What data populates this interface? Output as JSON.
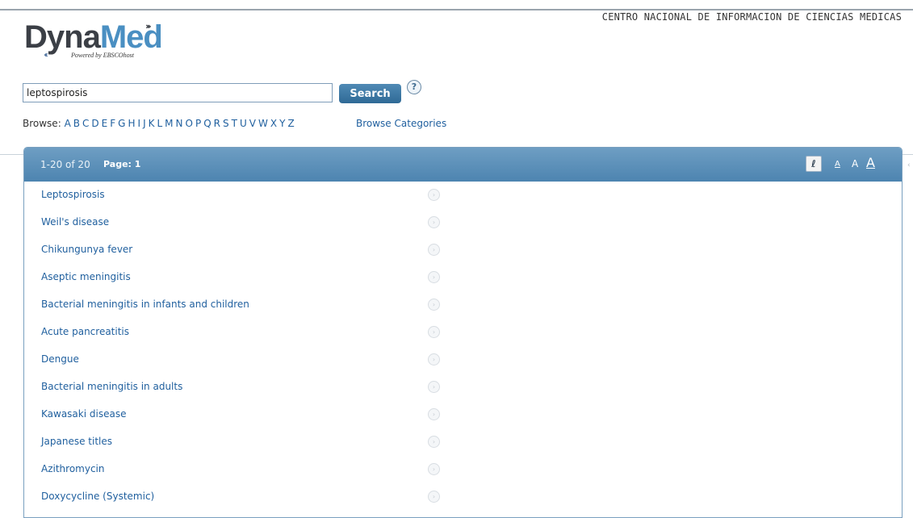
{
  "header": {
    "institution": "CENTRO NACIONAL DE INFORMACION DE CIENCIAS MEDICAS",
    "logo": {
      "part1": "Dyna",
      "part2": "Med",
      "tagline": "Powered by EBSCOhost"
    }
  },
  "search": {
    "value": "leptospirosis",
    "button_label": "Search",
    "help_label": "?"
  },
  "browse": {
    "label": "Browse:",
    "letters": [
      "A",
      "B",
      "C",
      "D",
      "E",
      "F",
      "G",
      "H",
      "I",
      "J",
      "K",
      "L",
      "M",
      "N",
      "O",
      "P",
      "Q",
      "R",
      "S",
      "T",
      "U",
      "V",
      "W",
      "X",
      "Y",
      "Z"
    ],
    "categories_label": "Browse Categories"
  },
  "results_header": {
    "count": "1-20 of 20",
    "page_label": "Page: 1",
    "link_icon": "link-icon",
    "font_small": "A",
    "font_medium": "A",
    "font_large": "A"
  },
  "results": [
    {
      "title": "Leptospirosis"
    },
    {
      "title": "Weil's disease"
    },
    {
      "title": "Chikungunya fever"
    },
    {
      "title": "Aseptic meningitis"
    },
    {
      "title": "Bacterial meningitis in infants and children"
    },
    {
      "title": "Acute pancreatitis"
    },
    {
      "title": "Dengue"
    },
    {
      "title": "Bacterial meningitis in adults"
    },
    {
      "title": "Kawasaki disease"
    },
    {
      "title": "Japanese titles"
    },
    {
      "title": "Azithromycin"
    },
    {
      "title": "Doxycycline (Systemic)"
    }
  ],
  "colors": {
    "accent": "#4d84b0",
    "link": "#1f5f9e",
    "button": "#2f6a96"
  }
}
